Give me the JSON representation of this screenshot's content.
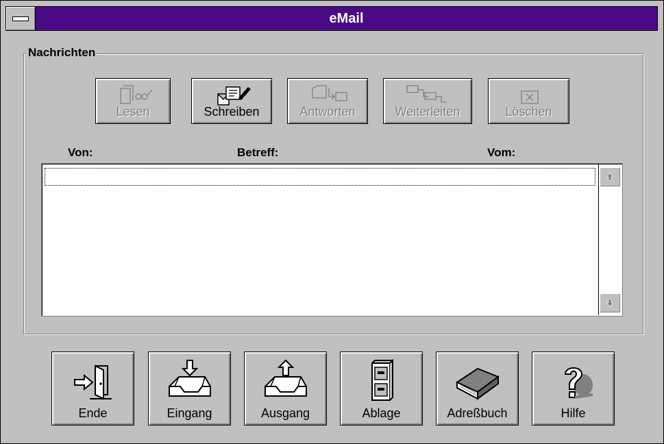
{
  "window": {
    "title": "eMail"
  },
  "group": {
    "label": "Nachrichten"
  },
  "toolbar": {
    "read": "Lesen",
    "write": "Schreiben",
    "reply": "Antworten",
    "forward": "Weiterleiten",
    "delete": "Löschen"
  },
  "columns": {
    "from": "Von:",
    "subject": "Betreff:",
    "date": "Vom:"
  },
  "buttons": {
    "exit": "Ende",
    "inbox": "Eingang",
    "outbox": "Ausgang",
    "archive": "Ablage",
    "addressbook": "Adreßbuch",
    "help": "Hilfe"
  },
  "colors": {
    "caption": "#4a0a85",
    "face": "#c0c0c0"
  }
}
